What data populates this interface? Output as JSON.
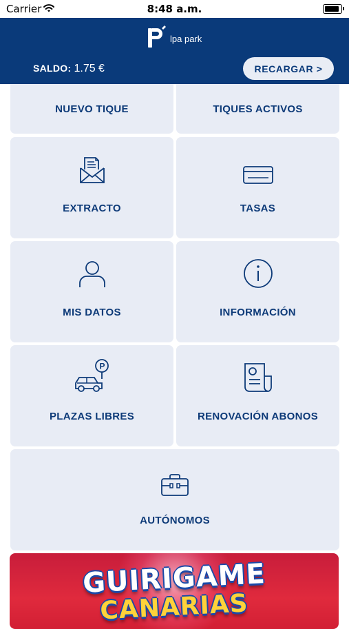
{
  "status_bar": {
    "carrier": "Carrier",
    "time": "8:48 a.m.",
    "icons": [
      "wifi-icon",
      "battery-icon"
    ]
  },
  "header": {
    "logo_text": "lpa park",
    "balance_label": "SALDO:",
    "balance_value": "1.75 €",
    "recharge_label": "RECARGAR >",
    "background_color": "#0a3a7a"
  },
  "tiles": [
    {
      "label": "NUEVO TIQUE",
      "icon": "none"
    },
    {
      "label": "TIQUES ACTIVOS",
      "icon": "none"
    },
    {
      "label": "EXTRACTO",
      "icon": "receipt-envelope-icon"
    },
    {
      "label": "TASAS",
      "icon": "credit-card-icon"
    },
    {
      "label": "MIS DATOS",
      "icon": "user-icon"
    },
    {
      "label": "INFORMACIÓN",
      "icon": "info-icon"
    },
    {
      "label": "PLAZAS LIBRES",
      "icon": "car-parking-icon"
    },
    {
      "label": "RENOVACIÓN ABONOS",
      "icon": "document-icon"
    },
    {
      "label": "AUTÓNOMOS",
      "icon": "briefcase-icon"
    }
  ],
  "banner": {
    "line1": "GUIRIGAME",
    "line2": "CANARIAS"
  },
  "colors": {
    "tile_bg": "#e8ecf5",
    "tile_text": "#0d3a78",
    "banner_bg": "#d21f34"
  }
}
